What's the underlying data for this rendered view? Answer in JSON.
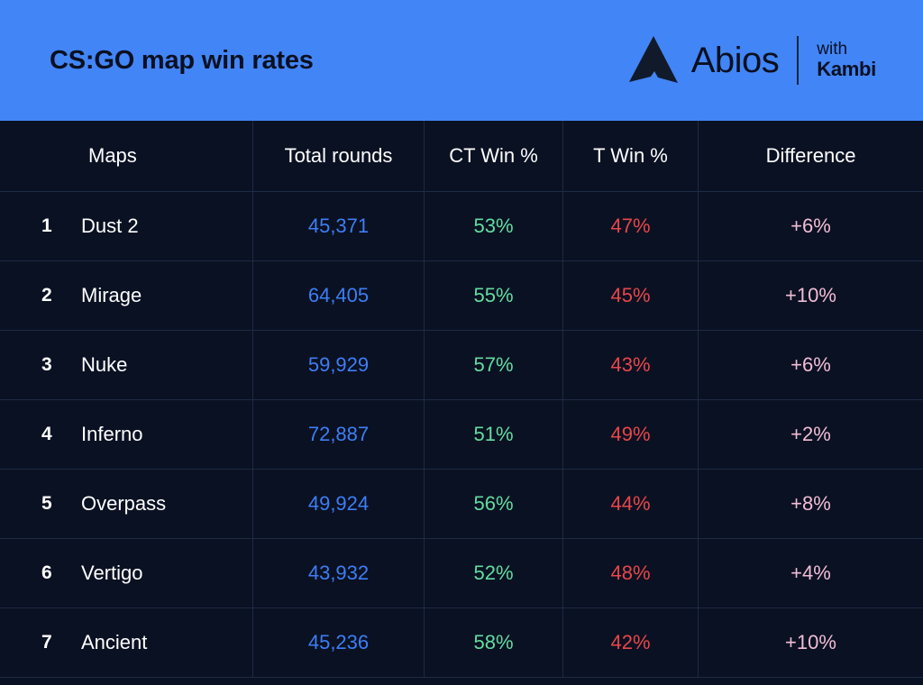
{
  "banner": {
    "title": "CS:GO map win rates",
    "brand_name": "Abios",
    "partner_prefix": "with",
    "partner_name": "Kambi",
    "logo_icon": "abios-arrow-logo-icon",
    "background_color": "#4285f7",
    "text_color": "#0b1020"
  },
  "theme": {
    "page_background": "#0a1122",
    "grid_line": "#1d2b45",
    "total_color": "#3d7ef5",
    "ct_color": "#63dca0",
    "t_color": "#e8464a",
    "difference_color": "#f1bdd6",
    "text_color": "#ffffff"
  },
  "table": {
    "headers": {
      "maps": "Maps",
      "total_rounds": "Total rounds",
      "ct_win": "CT Win %",
      "t_win": "T Win %",
      "difference": "Difference"
    },
    "rows": [
      {
        "rank": "1",
        "map": "Dust 2",
        "total_rounds": "45,371",
        "ct_win": "53%",
        "t_win": "47%",
        "difference": "+6%"
      },
      {
        "rank": "2",
        "map": "Mirage",
        "total_rounds": "64,405",
        "ct_win": "55%",
        "t_win": "45%",
        "difference": "+10%"
      },
      {
        "rank": "3",
        "map": "Nuke",
        "total_rounds": "59,929",
        "ct_win": "57%",
        "t_win": "43%",
        "difference": "+6%"
      },
      {
        "rank": "4",
        "map": "Inferno",
        "total_rounds": "72,887",
        "ct_win": "51%",
        "t_win": "49%",
        "difference": "+2%"
      },
      {
        "rank": "5",
        "map": "Overpass",
        "total_rounds": "49,924",
        "ct_win": "56%",
        "t_win": "44%",
        "difference": "+8%"
      },
      {
        "rank": "6",
        "map": "Vertigo",
        "total_rounds": "43,932",
        "ct_win": "52%",
        "t_win": "48%",
        "difference": "+4%"
      },
      {
        "rank": "7",
        "map": "Ancient",
        "total_rounds": "45,236",
        "ct_win": "58%",
        "t_win": "42%",
        "difference": "+10%"
      }
    ]
  },
  "chart_data": {
    "type": "table",
    "title": "CS:GO map win rates",
    "columns": [
      "Maps",
      "Total rounds",
      "CT Win %",
      "T Win %",
      "Difference"
    ],
    "categories": [
      "Dust 2",
      "Mirage",
      "Nuke",
      "Inferno",
      "Overpass",
      "Vertigo",
      "Ancient"
    ],
    "series": [
      {
        "name": "Total rounds",
        "values": [
          45371,
          64405,
          59929,
          72887,
          49924,
          43932,
          45236
        ]
      },
      {
        "name": "CT Win %",
        "values": [
          53,
          55,
          57,
          51,
          56,
          52,
          58
        ]
      },
      {
        "name": "T Win %",
        "values": [
          47,
          45,
          43,
          49,
          44,
          48,
          42
        ]
      },
      {
        "name": "Difference",
        "values": [
          6,
          10,
          6,
          2,
          8,
          4,
          10
        ]
      }
    ],
    "xlabel": "",
    "ylabel": "",
    "grid": true,
    "legend": "none"
  }
}
